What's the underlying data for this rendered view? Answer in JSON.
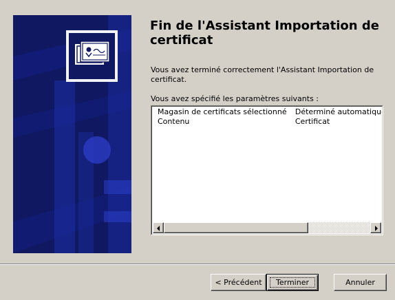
{
  "wizard": {
    "title": "Fin de l'Assistant Importation de certificat",
    "completion_message": "Vous avez terminé correctement l'Assistant Importation de certificat.",
    "params_label": "Vous avez spécifié les paramètres suivants :",
    "settings": [
      {
        "field": "Magasin de certificats sélectionné",
        "value": "Déterminé automatiquement"
      },
      {
        "field": "Contenu",
        "value": "Certificat"
      }
    ]
  },
  "buttons": {
    "previous": "< Précédent",
    "finish": "Terminer",
    "cancel": "Annuler"
  },
  "icons": {
    "banner": "certificate-icon",
    "scroll_left": "scroll-left-arrow-icon",
    "scroll_right": "scroll-right-arrow-icon"
  },
  "colors": {
    "dialog_bg": "#d4d0c8",
    "banner_bg": "#0f1860",
    "banner_accent": "#1a2a9a"
  }
}
